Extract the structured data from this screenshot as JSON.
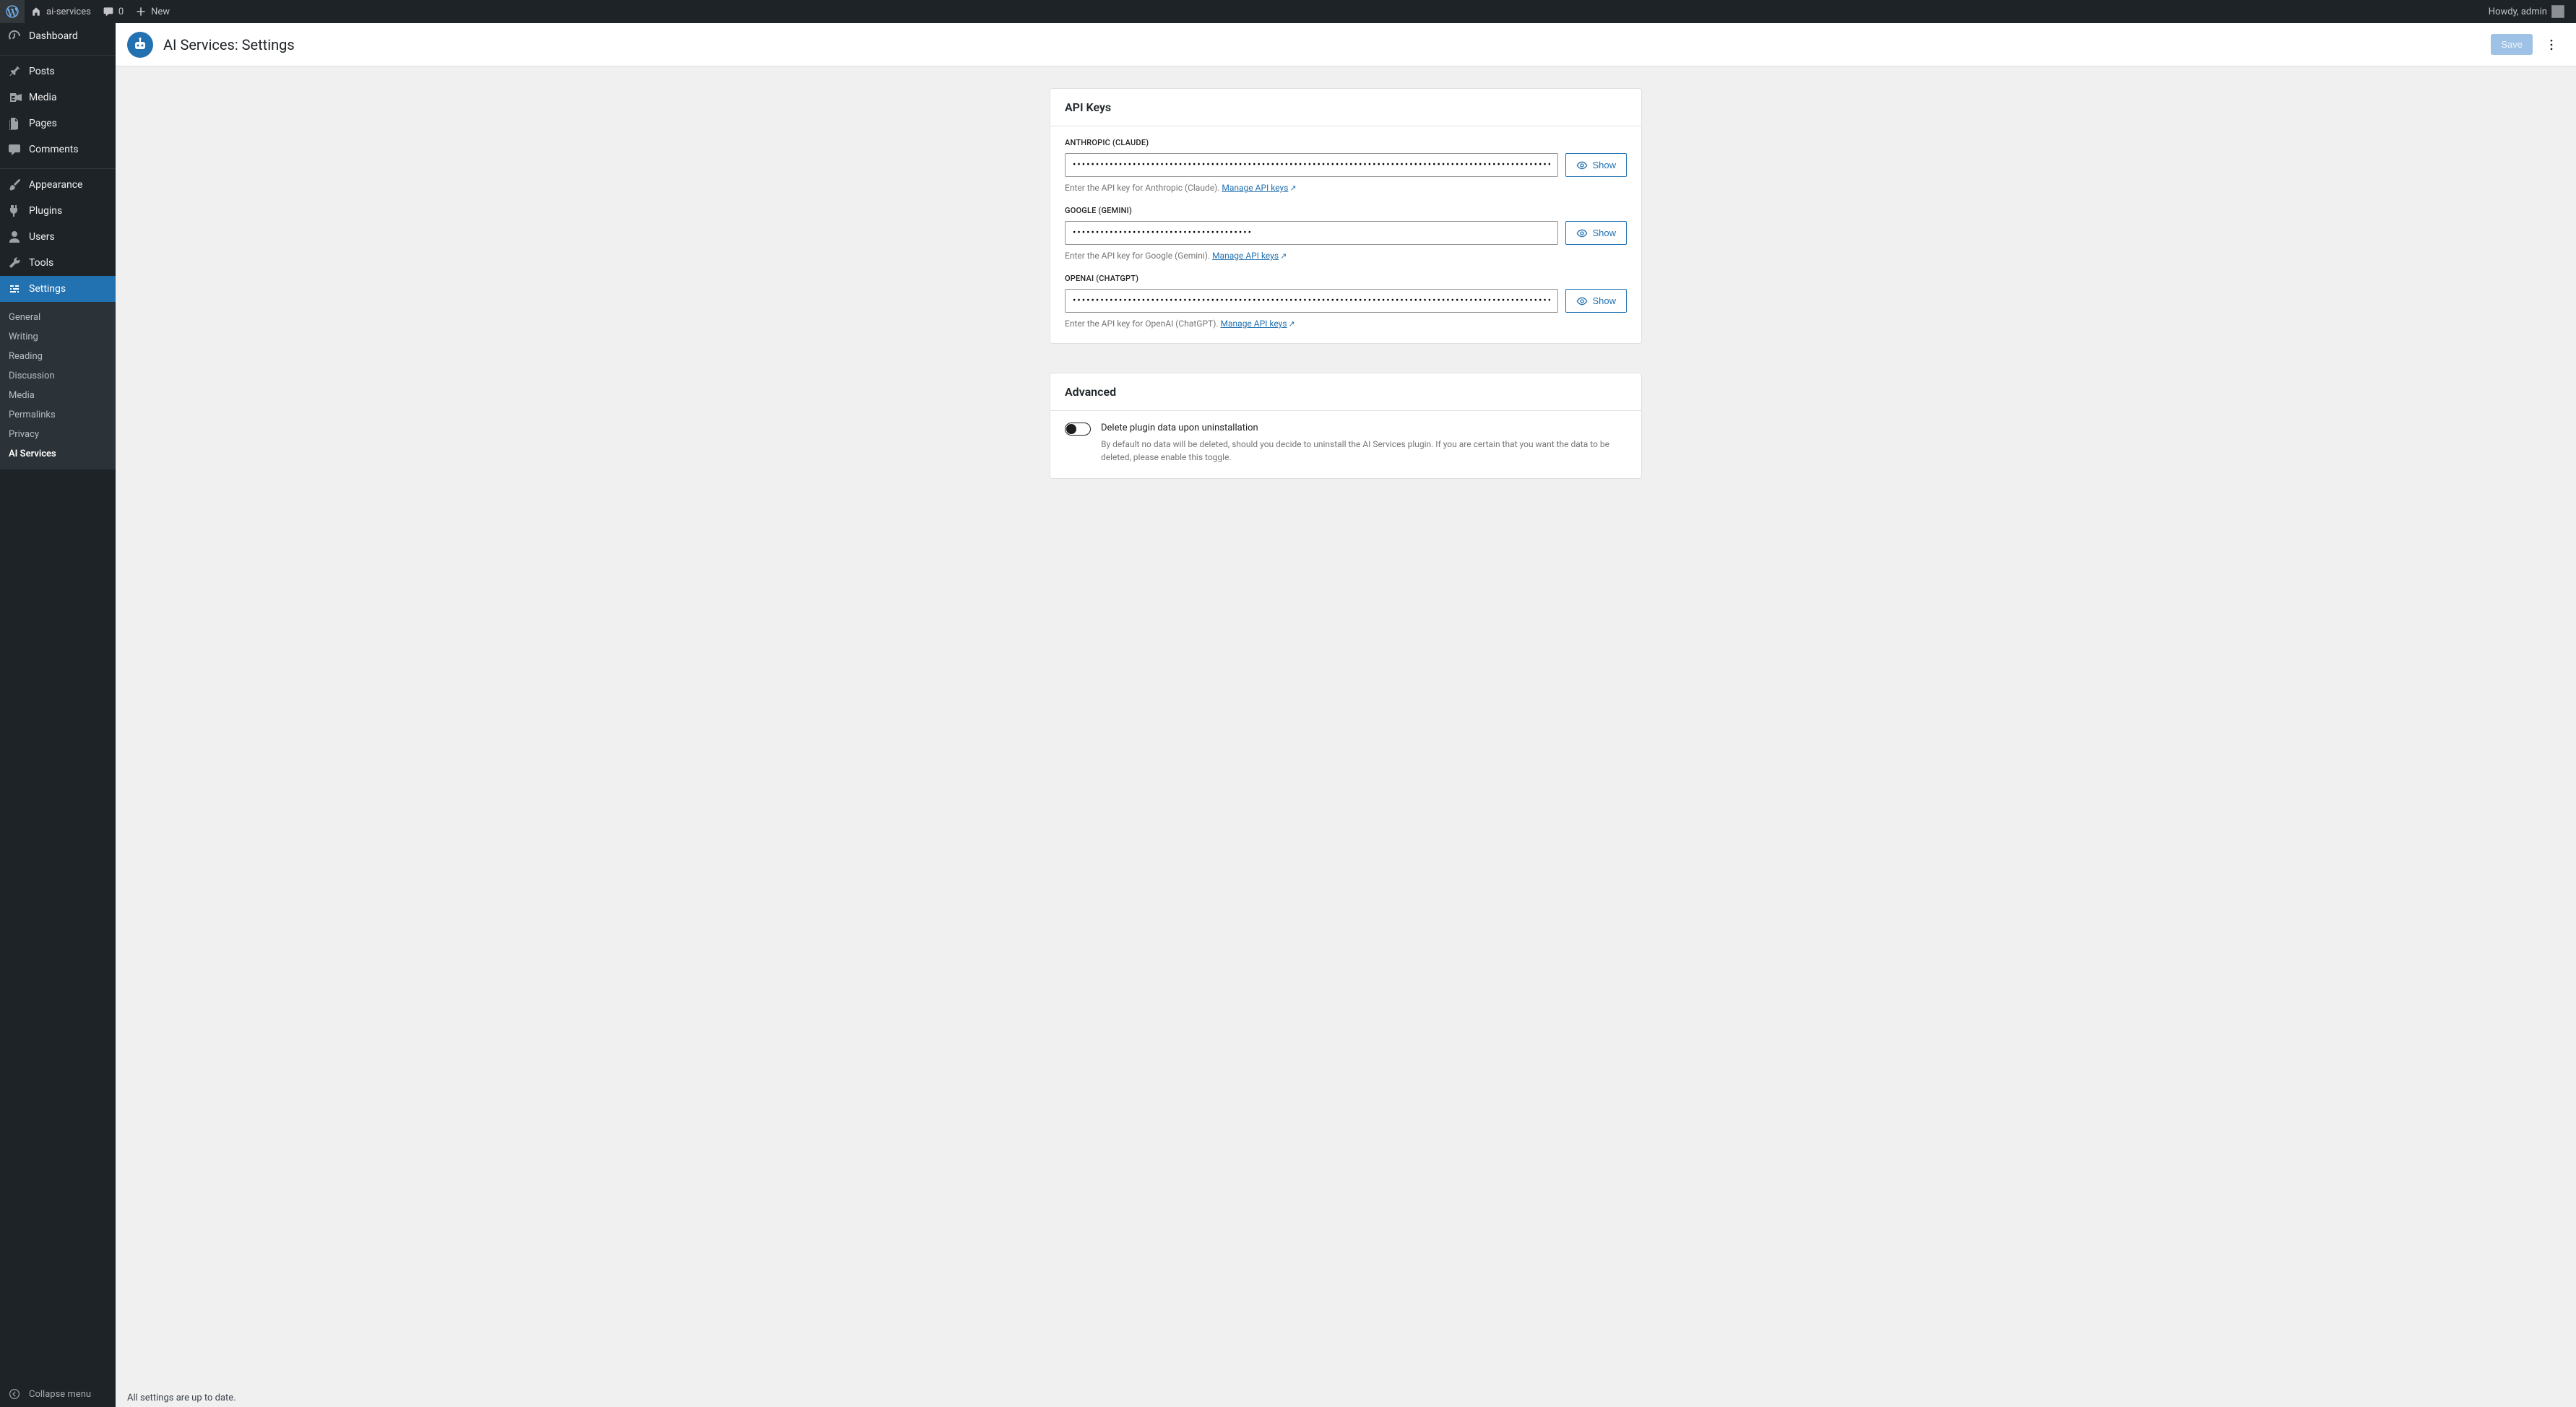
{
  "adminbar": {
    "site_name": "ai-services",
    "comments_count": "0",
    "new_label": "New",
    "howdy_prefix": "Howdy, ",
    "user_name": "admin"
  },
  "sidebar": {
    "items": [
      {
        "label": "Dashboard"
      },
      {
        "label": "Posts"
      },
      {
        "label": "Media"
      },
      {
        "label": "Pages"
      },
      {
        "label": "Comments"
      },
      {
        "label": "Appearance"
      },
      {
        "label": "Plugins"
      },
      {
        "label": "Users"
      },
      {
        "label": "Tools"
      },
      {
        "label": "Settings"
      }
    ],
    "settings_submenu": [
      "General",
      "Writing",
      "Reading",
      "Discussion",
      "Media",
      "Permalinks",
      "Privacy",
      "AI Services"
    ],
    "collapse_label": "Collapse menu"
  },
  "header": {
    "title": "AI Services: Settings",
    "save_label": "Save"
  },
  "panels": {
    "api_keys": {
      "title": "API Keys",
      "show_label": "Show",
      "manage_link_text": "Manage API keys",
      "fields": [
        {
          "label": "ANTHROPIC (CLAUDE)",
          "value": "••••••••••••••••••••••••••••••••••••••••••••••••••••••••••••••••••••••••••••••••••••••••••••••••••••••••••••",
          "help": "Enter the API key for Anthropic (Claude)."
        },
        {
          "label": "GOOGLE (GEMINI)",
          "value": "•••••••••••••••••••••••••••••••••••••••",
          "help": "Enter the API key for Google (Gemini)."
        },
        {
          "label": "OPENAI (CHATGPT)",
          "value": "••••••••••••••••••••••••••••••••••••••••••••••••••••••••••••••••••••••••••••••••••••••••••••••••••••••••••••••••",
          "help": "Enter the API key for OpenAI (ChatGPT)."
        }
      ]
    },
    "advanced": {
      "title": "Advanced",
      "toggle_label": "Delete plugin data upon uninstallation",
      "toggle_help": "By default no data will be deleted, should you decide to uninstall the AI Services plugin. If you are certain that you want the data to be deleted, please enable this toggle.",
      "toggle_on": false
    }
  },
  "status": {
    "message": "All settings are up to date."
  }
}
